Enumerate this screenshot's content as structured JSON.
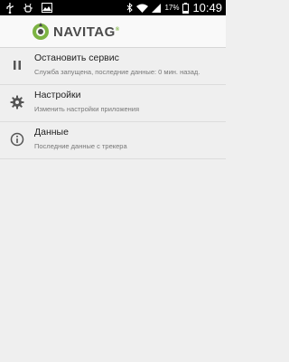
{
  "status_bar": {
    "battery_percent": "17%",
    "time": "10:49",
    "icons": [
      "usb-icon",
      "usb-debug-icon",
      "image-icon",
      "bluetooth-icon",
      "wifi-icon",
      "signal-icon",
      "battery-icon"
    ]
  },
  "app": {
    "logo_text": "NAVITAG",
    "logo_reg": "®",
    "accent_color": "#7cb342"
  },
  "menu": {
    "items": [
      {
        "title": "Остановить сервис",
        "subtitle": "Служба запущена, последние данные: 0 мин. назад.",
        "icon": "pause-icon"
      },
      {
        "title": "Настройки",
        "subtitle": "Изменить настройки приложения",
        "icon": "gear-icon"
      },
      {
        "title": "Данные",
        "subtitle": "Последние данные с трекера",
        "icon": "info-icon"
      }
    ]
  }
}
